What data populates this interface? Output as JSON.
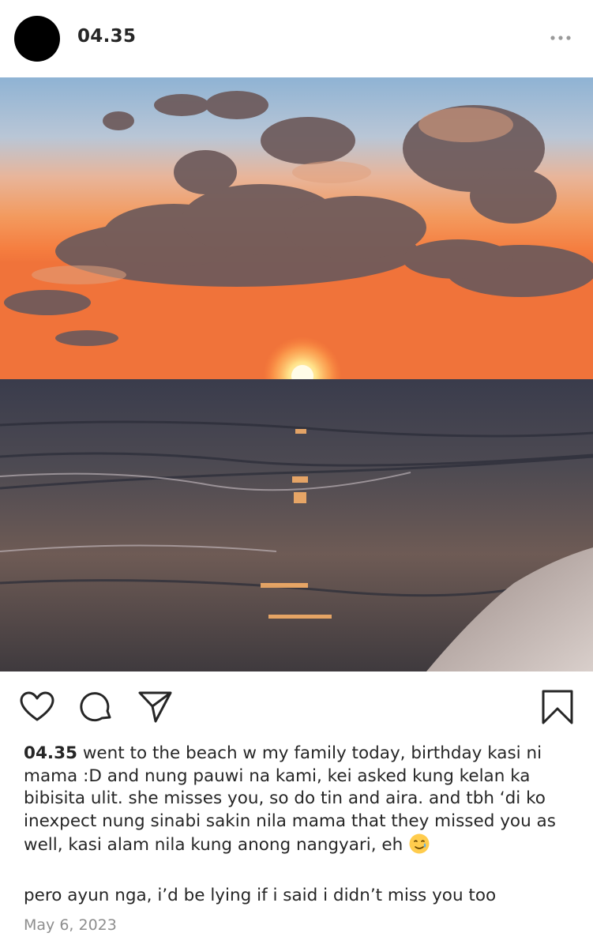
{
  "post": {
    "username": "04.35",
    "more_label": "more-options",
    "image_alt": "sunset over the sea at the beach"
  },
  "actions": {
    "like_icon": "heart-icon",
    "comment_icon": "comment-icon",
    "share_icon": "send-icon",
    "save_icon": "bookmark-icon"
  },
  "caption": {
    "username": "04.35",
    "text": " went to the beach w my family today, birthday kasi ni mama :D and nung pauwi na kami, kei asked kung kelan ka bibisita ulit. she misses you, so do tin and aira. and tbh ‘di ko inexpect nung sinabi sakin nila mama that they missed you as well, kasi alam nila kung anong nangyari, eh",
    "emoji": "smiling-face-with-tear",
    "second_line": "pero ayun nga, i’d be lying if i said i didn’t miss you too"
  },
  "meta": {
    "date": "May 6, 2023"
  },
  "colors": {
    "text": "#262626",
    "muted": "#8e8e8e"
  }
}
